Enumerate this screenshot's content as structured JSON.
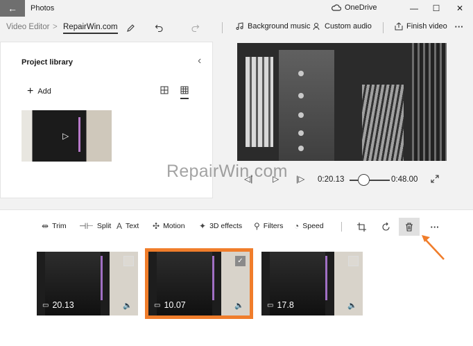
{
  "titlebar": {
    "app_title": "Photos",
    "onedrive_label": "OneDrive",
    "back_glyph": "←",
    "minimize_glyph": "—",
    "maximize_glyph": "☐",
    "close_glyph": "✕"
  },
  "breadcrumb": {
    "parent": "Video Editor",
    "separator": ">",
    "current": "RepairWin.com"
  },
  "commands": {
    "background_music": "Background music",
    "custom_audio": "Custom audio",
    "finish_video": "Finish video",
    "more_glyph": "···"
  },
  "library": {
    "title": "Project library",
    "add_label": "Add",
    "collapse_glyph": "‹"
  },
  "playback": {
    "current_time": "0:20.13",
    "total_time": "0:48.00",
    "progress": 0.42
  },
  "watermark": "RepairWin.com",
  "toolbar": {
    "trim": "Trim",
    "split": "Split",
    "text": "Text",
    "motion": "Motion",
    "effects_3d": "3D effects",
    "filters": "Filters",
    "speed": "Speed",
    "more_glyph": "···"
  },
  "storyboard": {
    "clips": [
      {
        "duration": "20.13",
        "selected": false
      },
      {
        "duration": "10.07",
        "selected": true
      },
      {
        "duration": "17.8",
        "selected": false
      }
    ]
  },
  "colors": {
    "selection": "#f07d2b",
    "back_button": "#6f6f6f",
    "annotation_arrow": "#f07d2b"
  },
  "icons": [
    "back-arrow-icon",
    "onedrive-cloud-icon",
    "minimize-icon",
    "maximize-icon",
    "close-icon",
    "pencil-icon",
    "undo-icon",
    "redo-icon",
    "music-note-icon",
    "microphone-icon",
    "share-icon",
    "more-icon",
    "chevron-left-icon",
    "plus-icon",
    "grid-large-icon",
    "grid-small-icon",
    "play-icon",
    "rewind-icon",
    "forward-icon",
    "expand-icon",
    "trim-icon",
    "split-icon",
    "text-icon",
    "motion-icon",
    "effects-3d-icon",
    "filters-icon",
    "speed-icon",
    "crop-icon",
    "rotate-icon",
    "trash-icon",
    "camera-icon",
    "volume-icon",
    "checkbox-icon"
  ]
}
